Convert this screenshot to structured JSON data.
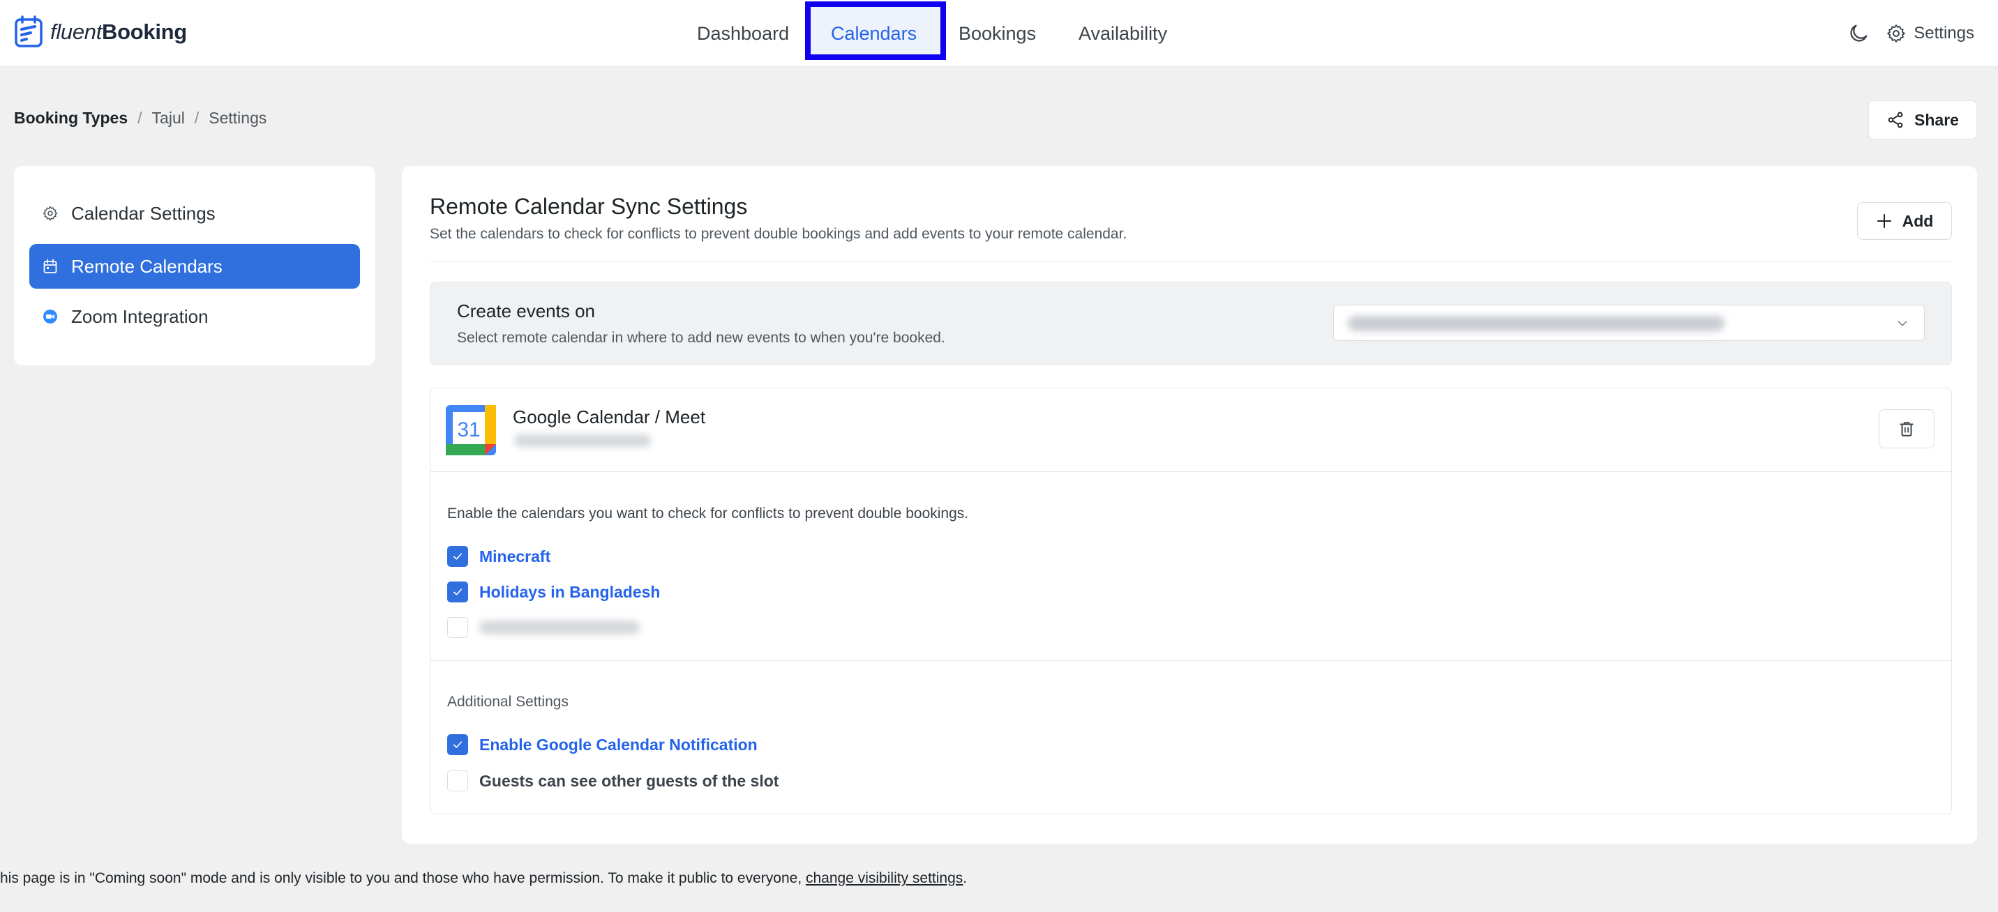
{
  "logo": {
    "text_light": "fluent",
    "text_bold": "Booking",
    "icon": "fluentbooking-logo-icon"
  },
  "nav": {
    "items": [
      {
        "label": "Dashboard",
        "active": false
      },
      {
        "label": "Calendars",
        "active": true
      },
      {
        "label": "Bookings",
        "active": false
      },
      {
        "label": "Availability",
        "active": false
      }
    ],
    "settings_label": "Settings",
    "theme_icon": "moon-icon",
    "settings_icon": "gear-icon"
  },
  "breadcrumb": {
    "items": [
      "Booking Types",
      "Tajul",
      "Settings"
    ],
    "separator": "/"
  },
  "share_label": "Share",
  "sidebar": {
    "items": [
      {
        "label": "Calendar Settings",
        "icon": "gear-icon",
        "active": false
      },
      {
        "label": "Remote Calendars",
        "icon": "calendar-icon",
        "active": true
      },
      {
        "label": "Zoom Integration",
        "icon": "zoom-icon",
        "active": false
      }
    ]
  },
  "main": {
    "title": "Remote Calendar Sync Settings",
    "description": "Set the calendars to check for conflicts to prevent double bookings and add events to your remote calendar.",
    "add_label": "Add",
    "create_events": {
      "title": "Create events on",
      "description": "Select remote calendar in where to add new events to when you're booked."
    },
    "provider": {
      "name": "Google Calendar / Meet",
      "logo_day": "31"
    },
    "conflict_description": "Enable the calendars you want to check for conflicts to prevent double bookings.",
    "calendars": [
      {
        "label": "Minecraft",
        "checked": true
      },
      {
        "label": "Holidays in Bangladesh",
        "checked": true
      }
    ],
    "additional_title": "Additional Settings",
    "additional": [
      {
        "label": "Enable Google Calendar Notification",
        "checked": true
      },
      {
        "label": "Guests can see other guests of the slot",
        "checked": false
      }
    ]
  },
  "footer": {
    "text": "his page is in \"Coming soon\" mode and is only visible to you and those who have permission. To make it public to everyone, ",
    "link": "change visibility settings",
    "end": "."
  },
  "colors": {
    "accent": "#2f6fde",
    "highlight_box": "#0f00f0",
    "background": "#f0f0f1"
  }
}
